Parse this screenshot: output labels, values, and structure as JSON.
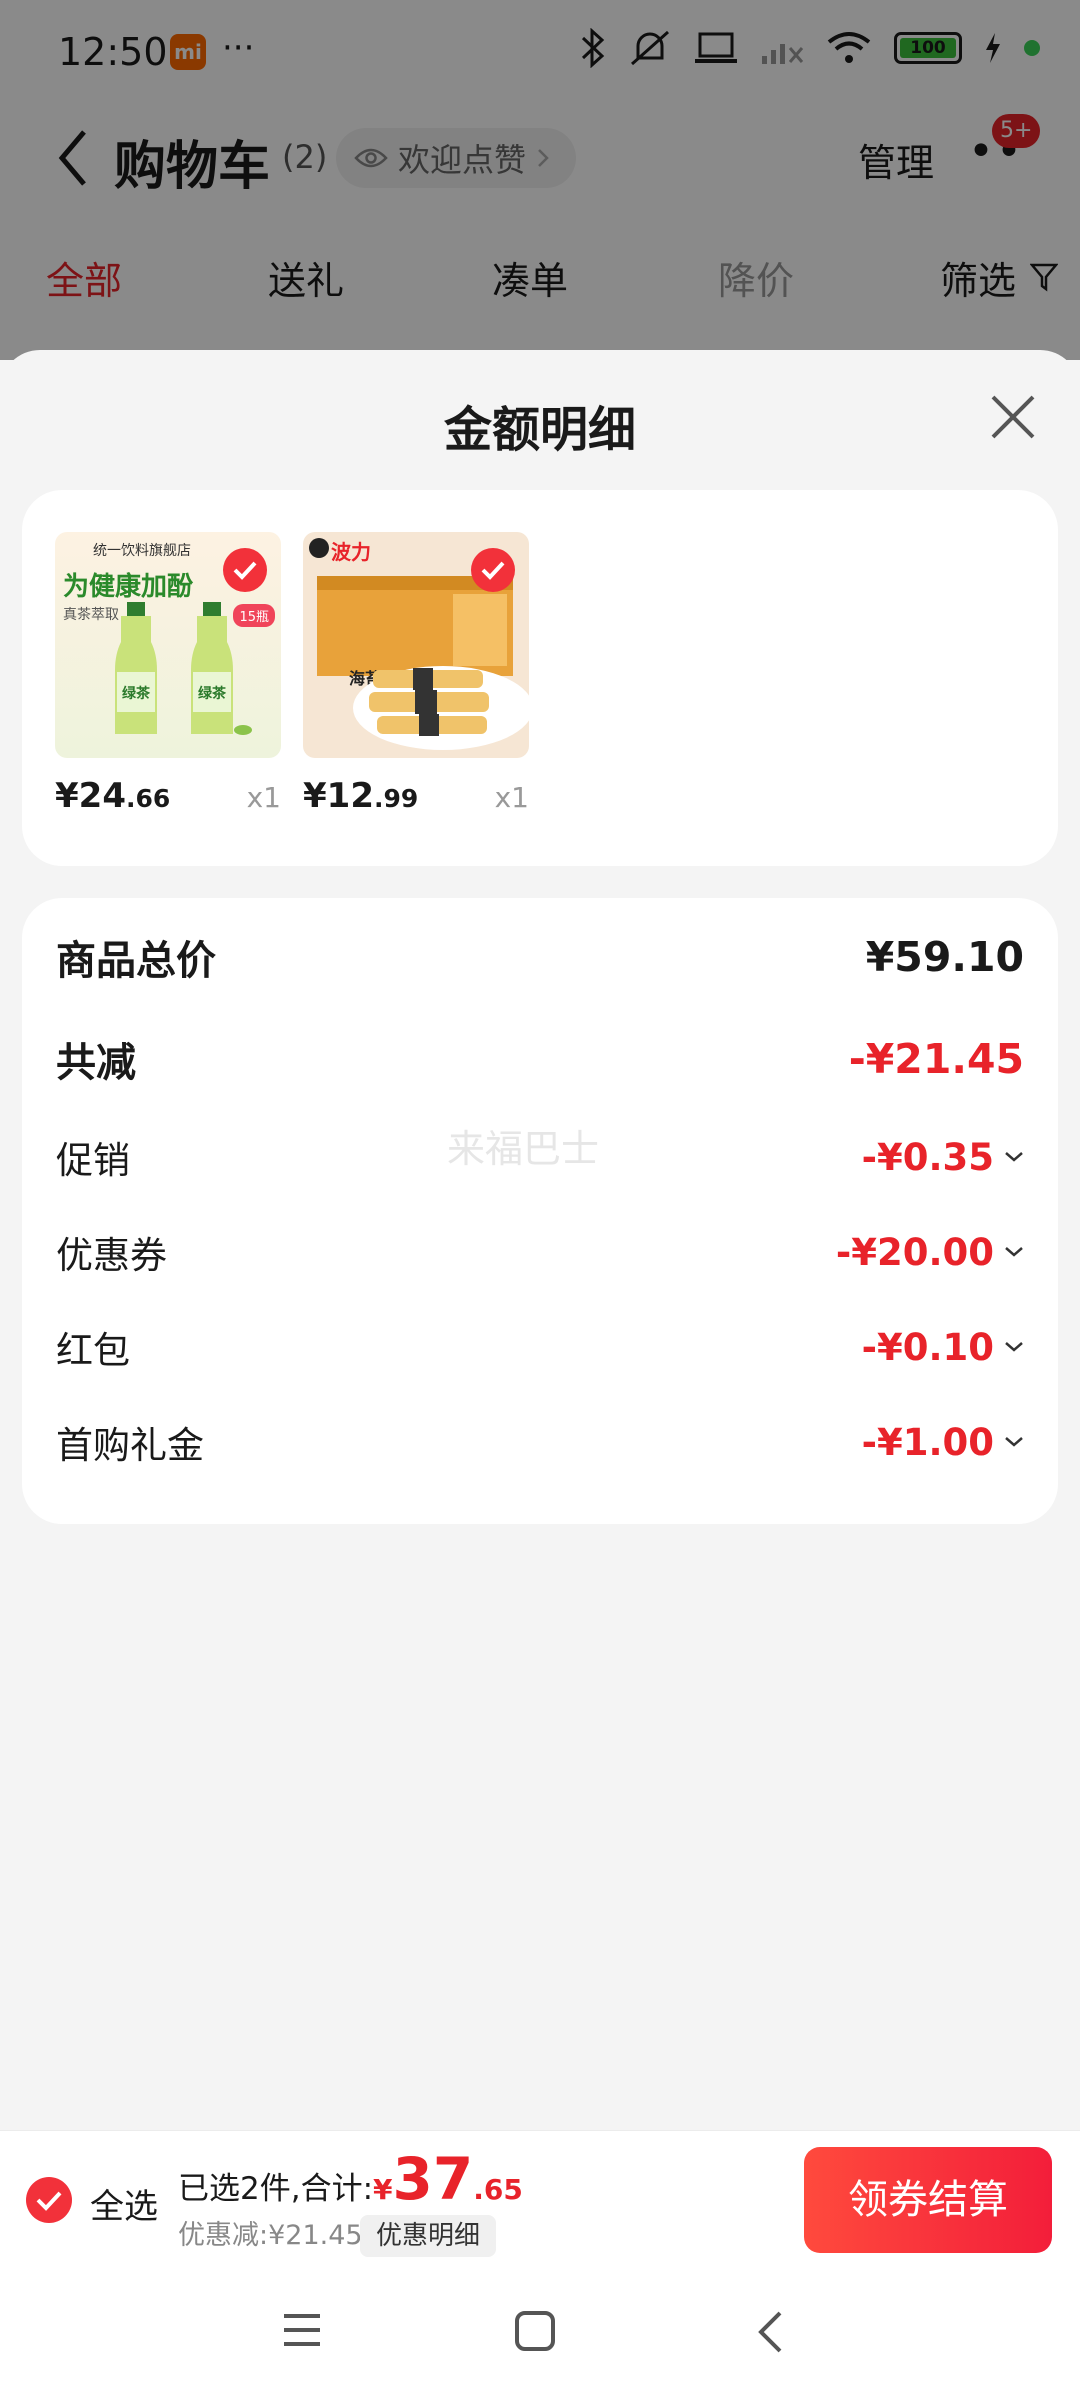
{
  "status_bar": {
    "time": "12:50",
    "mi_badge": "mi",
    "dots": "···",
    "battery": "100"
  },
  "header": {
    "title": "购物车",
    "count": "(2)",
    "like_text": "欢迎点赞",
    "manage": "管理",
    "more_badge": "5+"
  },
  "filter_tabs": [
    "全部",
    "送礼",
    "凑单",
    "降价",
    "筛选"
  ],
  "sheet": {
    "title": "金额明细",
    "products": [
      {
        "shop": "统一饮料旗舰店",
        "headline": "为健康加酚",
        "sub": "真茶萃取",
        "tag": "15瓶",
        "bottle_label": "绿茶",
        "price_int": "¥24",
        "price_dec": ".66",
        "qty": "x1"
      },
      {
        "brand": "波力",
        "label": "海苔",
        "price_int": "¥12",
        "price_dec": ".99",
        "qty": "x1"
      }
    ],
    "watermark": "来福巴士",
    "breakdown": {
      "total_label": "商品总价",
      "total_value": "¥59.10",
      "reduce_label": "共减",
      "reduce_value": "-¥21.45",
      "items": [
        {
          "label": "促销",
          "value": "-¥0.35"
        },
        {
          "label": "优惠券",
          "value": "-¥20.00"
        },
        {
          "label": "红包",
          "value": "-¥0.10"
        },
        {
          "label": "首购礼金",
          "value": "-¥1.00"
        }
      ]
    }
  },
  "bottom_bar": {
    "select_all": "全选",
    "selected_text": "已选2件,合计:",
    "yen": "¥",
    "total_int": "37",
    "total_dec": ".65",
    "discount_text": "优惠减:¥21.45",
    "detail_button": "优惠明细",
    "checkout": "领券结算"
  },
  "colors": {
    "accent": "#e8232a",
    "tab_active": "#e8232a"
  }
}
